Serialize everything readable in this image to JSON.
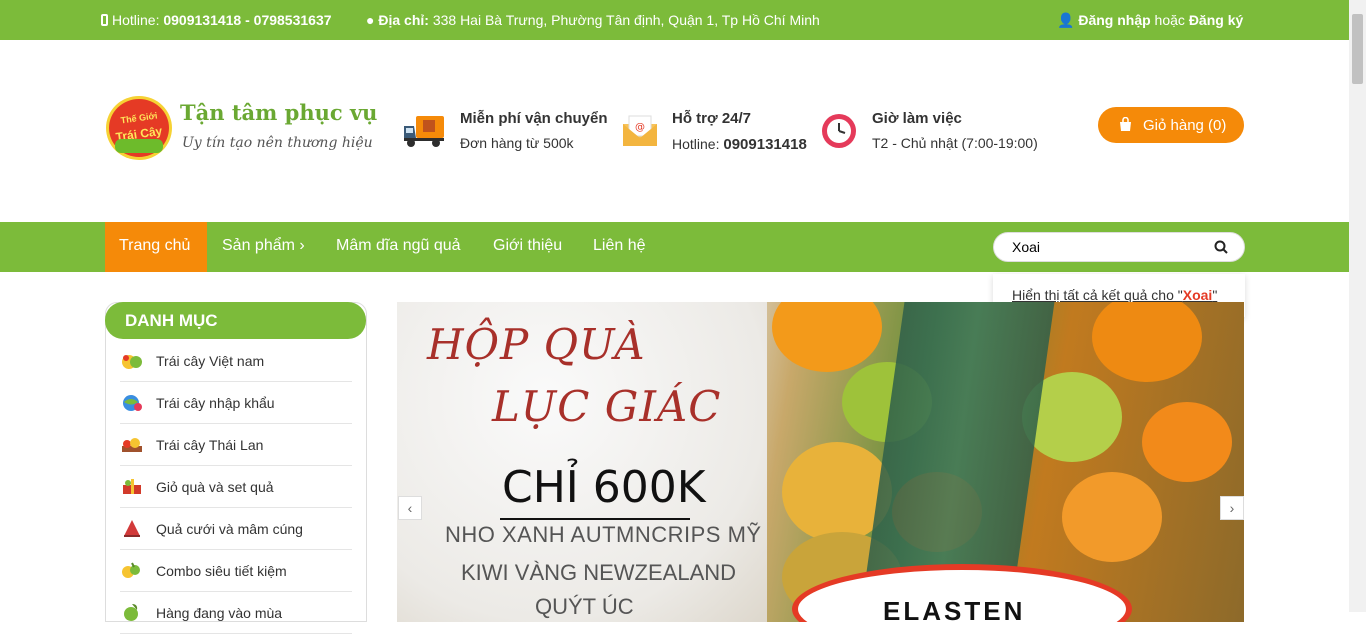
{
  "topbar": {
    "hotline_label": "Hotline: ",
    "hotline_value": "0909131418 - 0798531637",
    "address_label": "Địa chỉ: ",
    "address_value": "338 Hai Bà Trưng, Phường Tân định, Quận 1, Tp Hồ Chí Minh",
    "login": "Đăng nhập",
    "or": " hoặc ",
    "register": "Đăng ký"
  },
  "logo": {
    "badge_line1": "Thế Giới",
    "badge_line2": "Trái Cây",
    "slogan": "Tận tâm phục vụ",
    "tagline": "Uy tín tạo nên thương hiệu"
  },
  "features": [
    {
      "icon": "truck-icon",
      "title": "Miễn phí vận chuyển",
      "sub": "Đơn hàng từ 500k"
    },
    {
      "icon": "envelope-icon",
      "title": "Hỗ trợ 24/7",
      "sub_label": "Hotline: ",
      "sub_value": "0909131418"
    },
    {
      "icon": "clock-icon",
      "title": "Giờ làm việc",
      "sub": "T2 - Chủ nhật (7:00-19:00)"
    }
  ],
  "cart": {
    "label": "Giỏ hàng (0)"
  },
  "nav": {
    "items": [
      "Trang chủ",
      "Sản phẩm",
      "Mâm dĩa ngũ quả",
      "Giới thiệu",
      "Liên hệ"
    ],
    "products_caret": "›"
  },
  "search": {
    "value": "Xoai",
    "icon": "search-icon"
  },
  "suggest": {
    "prefix": "Hiển thị tất cả kết quả cho \"",
    "keyword": "Xoai",
    "suffix": "\""
  },
  "sidebar": {
    "title": "DANH MỤC",
    "items": [
      {
        "label": "Trái cây Việt nam"
      },
      {
        "label": "Trái cây nhập khẩu"
      },
      {
        "label": "Trái cây Thái Lan"
      },
      {
        "label": "Giỏ quà và set quả"
      },
      {
        "label": "Quả cưới và mâm cúng"
      },
      {
        "label": "Combo siêu tiết kiệm"
      },
      {
        "label": "Hàng đang vào mùa"
      }
    ]
  },
  "slider": {
    "line1": "HỘP QUÀ",
    "line2": "LỤC GIÁC",
    "price": "CHỈ 600K",
    "item1": "NHO XANH AUTMNCRIPS MỸ",
    "item2": "KIWI VÀNG NEWZEALAND",
    "item3": "QUÝT ÚC",
    "sticker": "ELASTEN",
    "prev": "‹",
    "next": "›"
  },
  "colors": {
    "green": "#7cbb3a",
    "orange": "#f58a09",
    "red": "#e53a25"
  }
}
